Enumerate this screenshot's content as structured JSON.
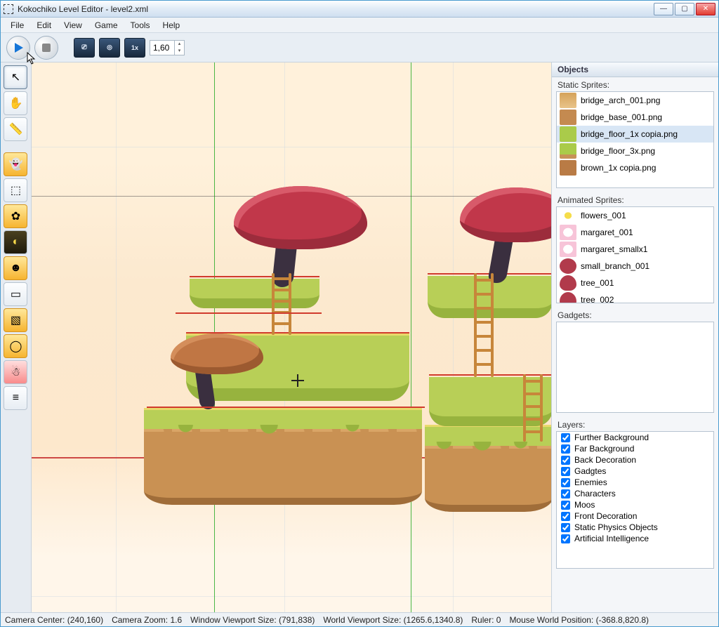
{
  "title": "Kokochiko Level Editor - level2.xml",
  "menu": {
    "file": "File",
    "edit": "Edit",
    "view": "View",
    "game": "Game",
    "tools": "Tools",
    "help": "Help"
  },
  "toolbar": {
    "zoom_value": "1,60"
  },
  "objects_panel": {
    "header": "Objects",
    "static_label": "Static Sprites:",
    "static_items": [
      {
        "name": "bridge_arch_001.png"
      },
      {
        "name": "bridge_base_001.png"
      },
      {
        "name": "bridge_floor_1x copia.png"
      },
      {
        "name": "bridge_floor_3x.png"
      },
      {
        "name": "brown_1x copia.png"
      }
    ],
    "animated_label": "Animated Sprites:",
    "animated_items": [
      {
        "name": "flowers_001"
      },
      {
        "name": "margaret_001"
      },
      {
        "name": "margaret_smallx1"
      },
      {
        "name": "small_branch_001"
      },
      {
        "name": "tree_001"
      },
      {
        "name": "tree_002"
      }
    ],
    "gadgets_label": "Gadgets:",
    "layers_label": "Layers:",
    "layers": [
      "Further Background",
      "Far Background",
      "Back Decoration",
      "Gadgtes",
      "Enemies",
      "Characters",
      "Moos",
      "Front Decoration",
      "Static Physics Objects",
      "Artificial Intelligence"
    ]
  },
  "status": {
    "camcenter_lbl": "Camera Center:",
    "camcenter_val": "(240,160)",
    "camzoom_lbl": "Camera Zoom:",
    "camzoom_val": "1.6",
    "winvp_lbl": "Window Viewport Size:",
    "winvp_val": "(791,838)",
    "worldvp_lbl": "World Viewport Size:",
    "worldvp_val": "(1265.6,1340.8)",
    "ruler_lbl": "Ruler:",
    "ruler_val": "0",
    "mouse_lbl": "Mouse World Position:",
    "mouse_val": "(-368.8,820.8)"
  }
}
